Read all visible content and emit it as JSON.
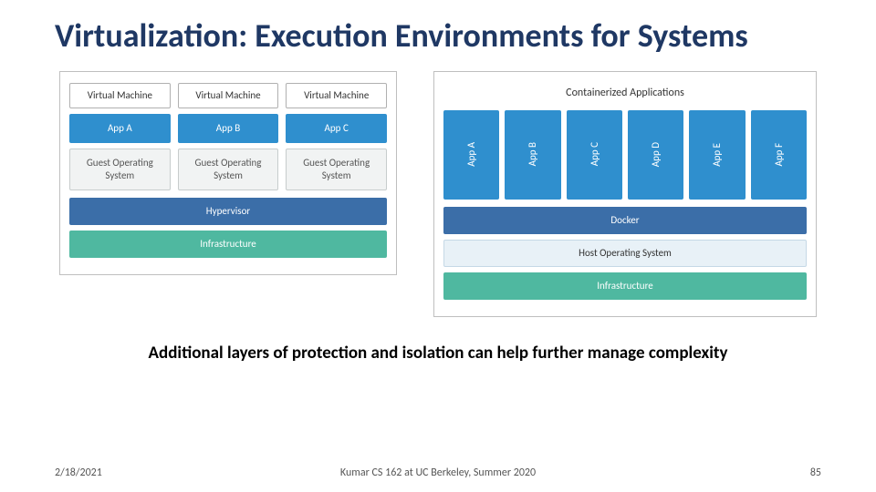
{
  "title": "Virtualization: Execution Environments for Systems",
  "vm": {
    "cols": [
      {
        "label": "Virtual Machine",
        "app": "App A",
        "guest": "Guest\nOperating\nSystem"
      },
      {
        "label": "Virtual Machine",
        "app": "App B",
        "guest": "Guest\nOperating\nSystem"
      },
      {
        "label": "Virtual Machine",
        "app": "App C",
        "guest": "Guest\nOperating\nSystem"
      }
    ],
    "hypervisor": "Hypervisor",
    "infrastructure": "Infrastructure"
  },
  "containers": {
    "header": "Containerized Applications",
    "apps": [
      "App A",
      "App B",
      "App C",
      "App D",
      "App E",
      "App F"
    ],
    "docker": "Docker",
    "host_os": "Host Operating System",
    "infrastructure": "Infrastructure"
  },
  "subtitle": "Additional layers of protection and isolation can help further manage complexity",
  "footer": {
    "date": "2/18/2021",
    "center": "Kumar CS 162 at UC Berkeley, Summer 2020",
    "page": "85"
  }
}
